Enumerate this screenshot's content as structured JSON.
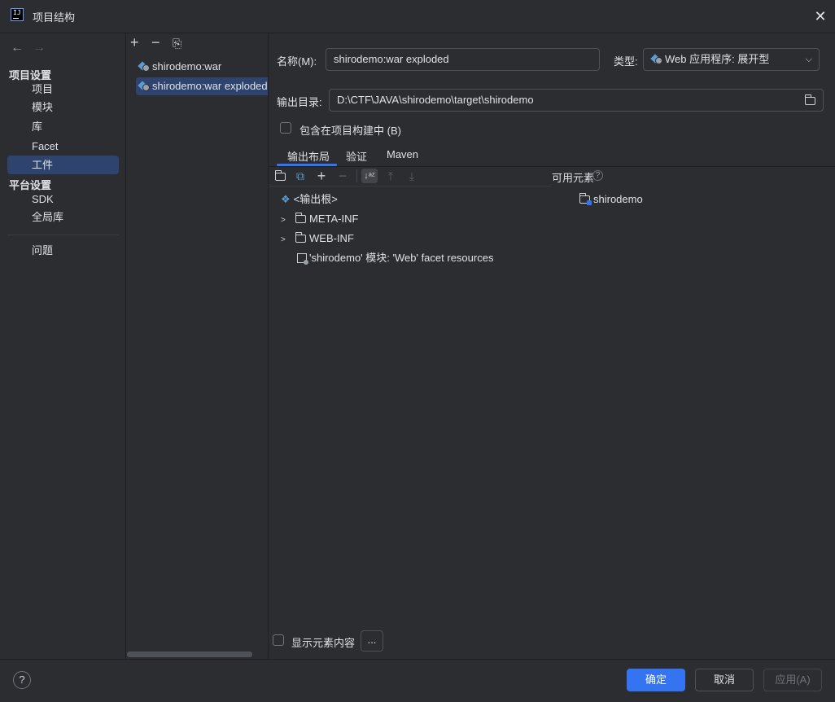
{
  "window": {
    "title": "项目结构"
  },
  "nav": {
    "back": "←",
    "forward": "→",
    "project_settings_header": "项目设置",
    "project_items": [
      "项目",
      "模块",
      "库",
      "Facet",
      "工件"
    ],
    "platform_settings_header": "平台设置",
    "platform_items": [
      "SDK",
      "全局库"
    ],
    "problems": "问题",
    "selected": "工件"
  },
  "artifacts": {
    "toolbar": {
      "add": "+",
      "remove": "−",
      "copy": "⎘"
    },
    "items": [
      "shirodemo:war",
      "shirodemo:war exploded"
    ],
    "selected_index": 1
  },
  "form": {
    "name_label": "名称(M):",
    "name_value": "shirodemo:war exploded",
    "type_label": "类型:",
    "type_value": "Web 应用程序: 展开型",
    "output_dir_label": "输出目录:",
    "output_dir_value": "D:\\CTF\\JAVA\\shirodemo\\target\\shirodemo",
    "include_in_build_label": "包含在项目构建中 (B)",
    "include_in_build_checked": false
  },
  "tabs": [
    "输出布局",
    "验证",
    "Maven"
  ],
  "active_tab": "输出布局",
  "output_layout": {
    "tree": [
      {
        "label": "<输出根>",
        "type": "root"
      },
      {
        "label": "META-INF",
        "type": "folder"
      },
      {
        "label": "WEB-INF",
        "type": "folder"
      },
      {
        "label": "'shirodemo' 模块: 'Web' facet resources",
        "type": "module"
      }
    ],
    "available_label": "可用元素",
    "available_items": [
      "shirodemo"
    ],
    "show_content_label": "显示元素内容",
    "show_content_checked": false,
    "more_button": "..."
  },
  "buttons": {
    "ok": "确定",
    "cancel": "取消",
    "apply": "应用(A)"
  },
  "colors": {
    "accent": "#3574f0",
    "selection": "#2e436e",
    "background": "#2b2d30"
  }
}
